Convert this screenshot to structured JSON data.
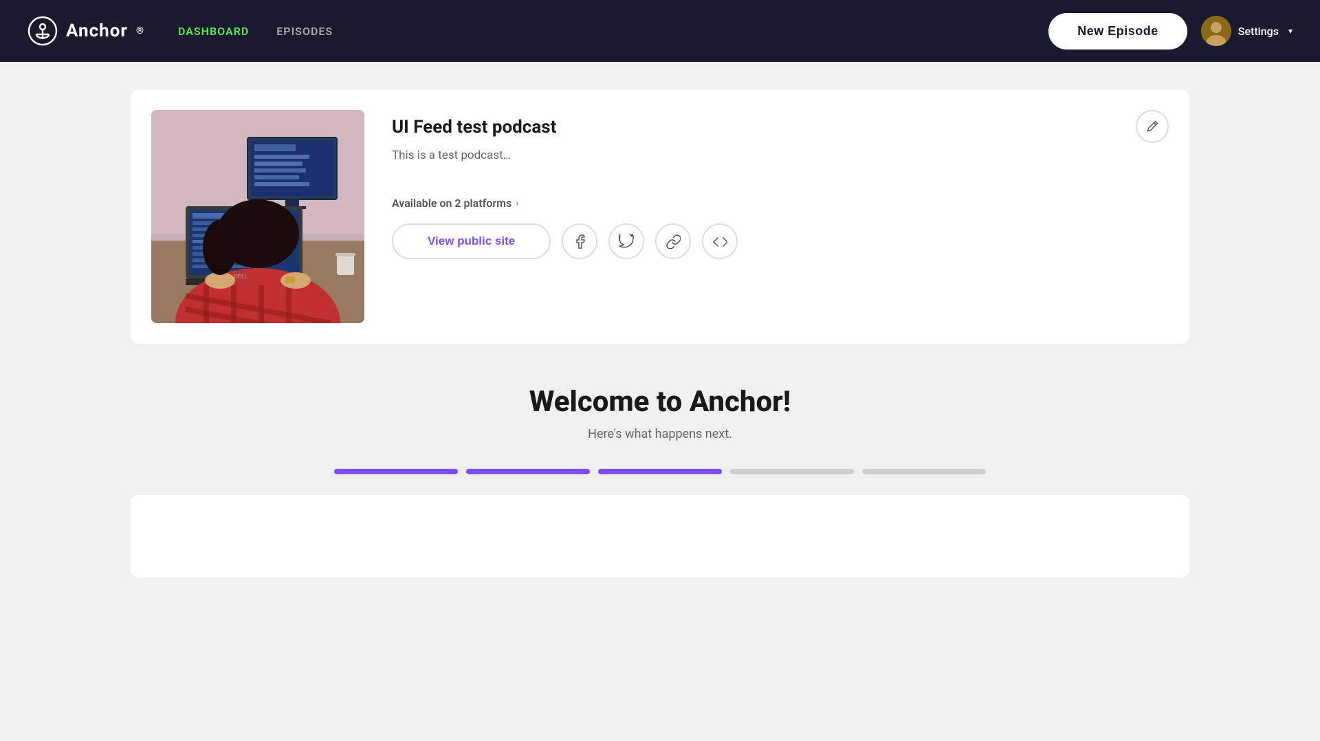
{
  "app": {
    "name": "Anchor",
    "logo_symbol": "◎"
  },
  "navbar": {
    "links": [
      {
        "label": "DASHBOARD",
        "active": true
      },
      {
        "label": "EPISODES",
        "active": false
      }
    ],
    "new_episode_label": "New Episode",
    "settings_label": "Settings"
  },
  "podcast_card": {
    "title": "UI Feed test podcast",
    "description": "This is a test podcast…",
    "platforms_text": "Available on 2 platforms",
    "view_public_label": "View public site",
    "edit_icon": "✏"
  },
  "welcome": {
    "title": "Welcome to Anchor!",
    "subtitle": "Here's what happens next.",
    "steps": [
      {
        "completed": true
      },
      {
        "completed": true
      },
      {
        "completed": true
      },
      {
        "completed": false
      },
      {
        "completed": false
      }
    ]
  },
  "social_icons": {
    "facebook": "f",
    "twitter": "t",
    "link": "🔗",
    "embed": "</>"
  }
}
